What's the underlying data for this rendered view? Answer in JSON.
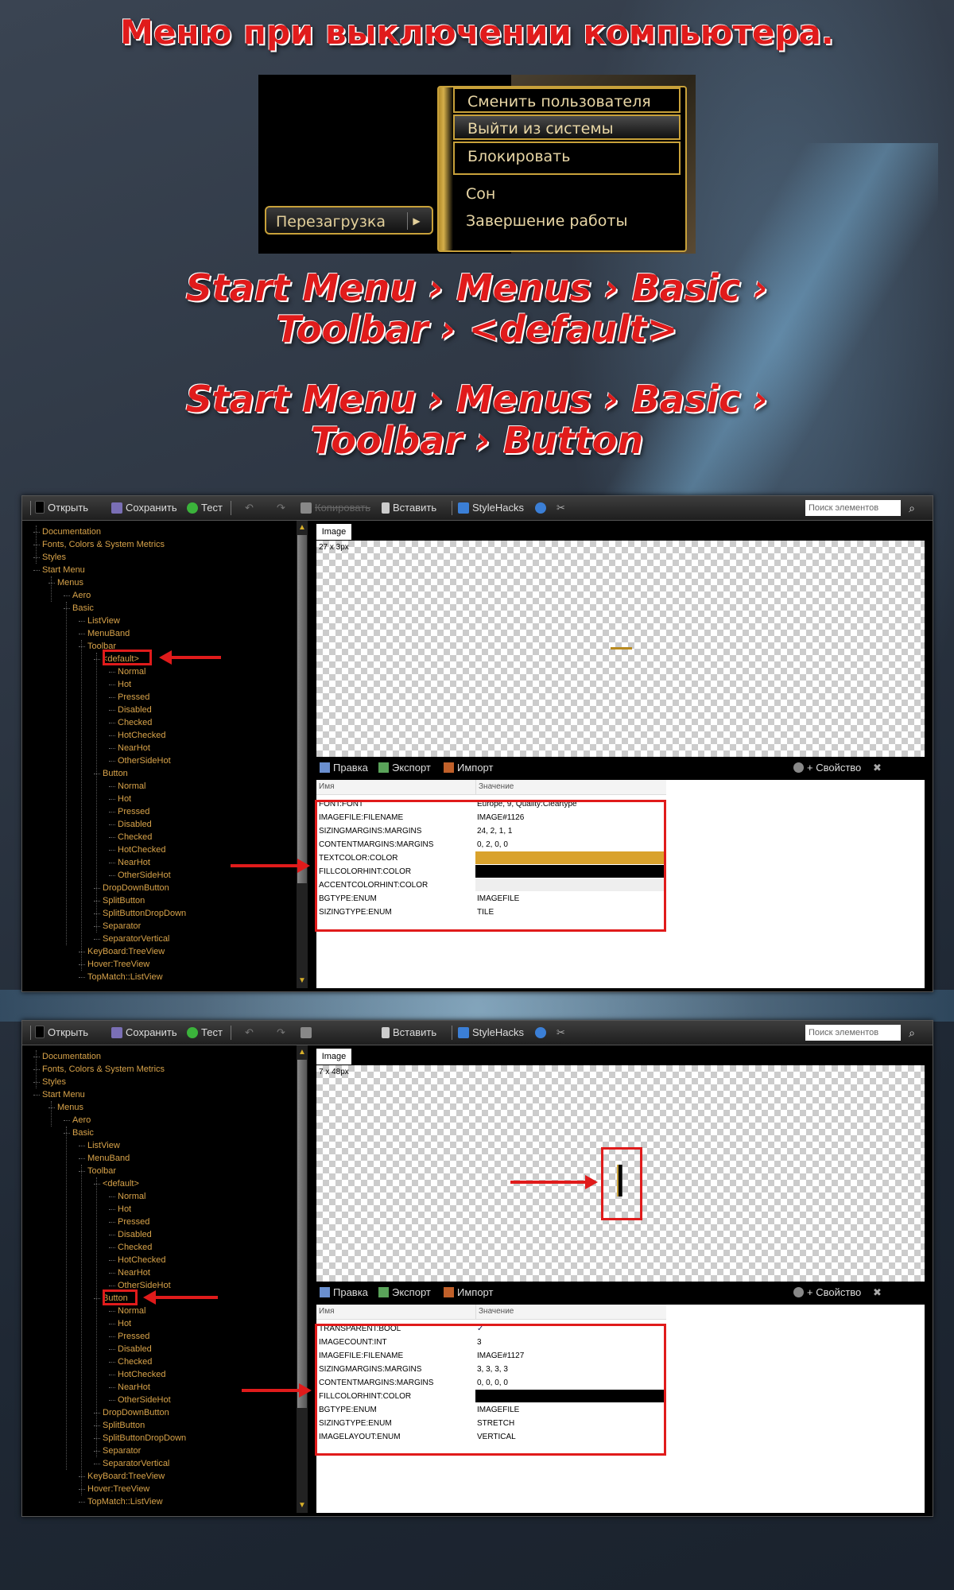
{
  "header": {
    "title": "Меню при выключении компьютера.",
    "path1_line1": "Start Menu › Menus ›  Basic ›",
    "path1_line2": "Toolbar › <default>",
    "path2_line1": "Start Menu › Menus ›  Basic ›",
    "path2_line2": "Toolbar › Button"
  },
  "shutdown_menu": {
    "items": [
      "Сменить пользователя",
      "Выйти из системы",
      "Блокировать",
      "Сон",
      "Завершение работы"
    ],
    "restart_button": "Перезагрузка",
    "restart_arrow": "▶"
  },
  "toolbar": {
    "open": "Открыть",
    "save": "Сохранить",
    "test": "Тест",
    "copy": "Копировать",
    "paste": "Вставить",
    "stylehacks": "StyleHacks",
    "search_placeholder": "Поиск элементов",
    "search_icon": "⌕"
  },
  "tree_labels": [
    "Documentation",
    "Fonts, Colors & System Metrics",
    "Styles",
    "Start Menu",
    "Menus",
    "Aero",
    "Basic",
    "ListView",
    "MenuBand",
    "Toolbar",
    "<default>",
    "Normal",
    "Hot",
    "Pressed",
    "Disabled",
    "Checked",
    "HotChecked",
    "NearHot",
    "OtherSideHot",
    "Button",
    "Normal",
    "Hot",
    "Pressed",
    "Disabled",
    "Checked",
    "HotChecked",
    "NearHot",
    "OtherSideHot",
    "DropDownButton",
    "SplitButton",
    "SplitButtonDropDown",
    "Separator",
    "SeparatorVertical",
    "KeyBoard:TreeView",
    "Hover:TreeView",
    "TopMatch::ListView"
  ],
  "panel": {
    "tab": "Image",
    "edit": "Правка",
    "export": "Экспорт",
    "import": "Импорт",
    "add_property": "+ Свойство",
    "close": "✖",
    "col_name": "Имя",
    "col_value": "Значение"
  },
  "window1": {
    "size_label": "27 x 3px",
    "props": [
      {
        "k": "FONT:FONT",
        "v": "Europe, 9, Quality:Cleartype"
      },
      {
        "k": "IMAGEFILE:FILENAME",
        "v": "IMAGE#1126"
      },
      {
        "k": "SIZINGMARGINS:MARGINS",
        "v": "24, 2, 1, 1"
      },
      {
        "k": "CONTENTMARGINS:MARGINS",
        "v": "0, 2, 0, 0"
      },
      {
        "k": "TEXTCOLOR:COLOR",
        "v": ""
      },
      {
        "k": "FILLCOLORHINT:COLOR",
        "v": ""
      },
      {
        "k": "ACCENTCOLORHINT:COLOR",
        "v": ""
      },
      {
        "k": "BGTYPE:ENUM",
        "v": "IMAGEFILE"
      },
      {
        "k": "SIZINGTYPE:ENUM",
        "v": "TILE"
      }
    ]
  },
  "window2": {
    "size_label": "7 x 48px",
    "props": [
      {
        "k": "TRANSPARENT:BOOL",
        "v": "✓"
      },
      {
        "k": "IMAGECOUNT:INT",
        "v": "3"
      },
      {
        "k": "IMAGEFILE:FILENAME",
        "v": "IMAGE#1127"
      },
      {
        "k": "SIZINGMARGINS:MARGINS",
        "v": "3, 3, 3, 3"
      },
      {
        "k": "CONTENTMARGINS:MARGINS",
        "v": "0, 0, 0, 0"
      },
      {
        "k": "FILLCOLORHINT:COLOR",
        "v": ""
      },
      {
        "k": "BGTYPE:ENUM",
        "v": "IMAGEFILE"
      },
      {
        "k": "SIZINGTYPE:ENUM",
        "v": "STRETCH"
      },
      {
        "k": "IMAGELAYOUT:ENUM",
        "v": "VERTICAL"
      }
    ]
  },
  "colors": {
    "textcolor_swatch": "#d9a22c",
    "fillcolorhint_swatch": "#000000",
    "accent_swatch": "#eeeeee",
    "tree_text": "#d8a34a",
    "highlight_red": "#e01b1b"
  }
}
